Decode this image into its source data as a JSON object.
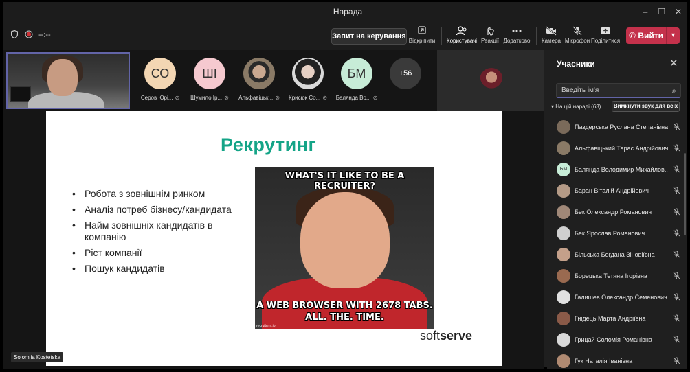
{
  "window": {
    "title": "Нарада",
    "minimize": "–",
    "maximize": "❐",
    "close": "✕"
  },
  "toolbar": {
    "timer": "--:--",
    "request_control": "Запит на керування",
    "buttons": [
      {
        "label": "Відкріпити",
        "icon": "unpin-icon"
      },
      {
        "label": "Користувачі",
        "icon": "people-icon"
      },
      {
        "label": "Реакції",
        "icon": "reactions-icon"
      },
      {
        "label": "Додатково",
        "icon": "more-icon"
      },
      {
        "label": "Камера",
        "icon": "camera-off-icon"
      },
      {
        "label": "Мікрофон",
        "icon": "mic-off-icon"
      },
      {
        "label": "Поділитися",
        "icon": "share-icon"
      }
    ],
    "leave": "Вийти"
  },
  "participants_strip": [
    {
      "initials": "СО",
      "name": "Серов Юрі...",
      "color": "#f3d6b3"
    },
    {
      "initials": "ШІ",
      "name": "Шумило Ір...",
      "color": "#f5c9cf"
    },
    {
      "initials": "",
      "name": "Альфавіцьк...",
      "color": "#8a7a66"
    },
    {
      "initials": "",
      "name": "Крисюк Со...",
      "color": "#d9d9d9"
    },
    {
      "initials": "БМ",
      "name": "Баляндa Во...",
      "color": "#c7ecd7"
    }
  ],
  "more_count": "+56",
  "slide": {
    "title": "Рекрутинг",
    "bullets": [
      "Робота з зовнішнім ринком",
      "Аналіз потреб бізнесу/кандидата",
      "Найм зовнішніх кандидатів в компанію",
      "Ріст компанії",
      "Пошук кандидатів"
    ],
    "meme_top": "WHAT'S IT LIKE TO BE A RECRUITER?",
    "meme_bottom_1": "A WEB BROWSER WITH 2678 TABS.",
    "meme_bottom_2": "ALL. THE. TIME.",
    "meme_source": "recruitcrm.io",
    "brand_a": "soft",
    "brand_b": "serve"
  },
  "self_name": "Solomiia Kostetska",
  "panel": {
    "title": "Учасники",
    "search_placeholder": "Введіть ім'я",
    "section": "На цій нараді (63)",
    "mute_all": "Вимкнути звук для всіх",
    "people": [
      {
        "name": "Паздерська Руслана Степанівна",
        "initials": "",
        "color": "#7a6a5a"
      },
      {
        "name": "Альфавіцький Тарас Андрійович",
        "initials": "",
        "color": "#8a7a66"
      },
      {
        "name": "Баляндa Володимир Михайлов...",
        "initials": "БМ",
        "color": "#c7ecd7"
      },
      {
        "name": "Баран Віталій Андрійович",
        "initials": "",
        "color": "#b49a86"
      },
      {
        "name": "Бек Олександр Романович",
        "initials": "",
        "color": "#a08878"
      },
      {
        "name": "Бек Ярослав Романович",
        "initials": "",
        "color": "#cfcfcf"
      },
      {
        "name": "Більська Богдана Зіновіївна",
        "initials": "",
        "color": "#c4a08a"
      },
      {
        "name": "Борецька Тетяна Ігорівна",
        "initials": "",
        "color": "#9a6a50"
      },
      {
        "name": "Галишев Олександр Семенович",
        "initials": "",
        "color": "#e0e0e0"
      },
      {
        "name": "Гнідець Марта Андріївна",
        "initials": "",
        "color": "#8a5a48"
      },
      {
        "name": "Грицай Соломія Романівна",
        "initials": "",
        "color": "#d8d8d8"
      },
      {
        "name": "Гук Наталія Іванівна",
        "initials": "",
        "color": "#b08a72"
      }
    ]
  }
}
